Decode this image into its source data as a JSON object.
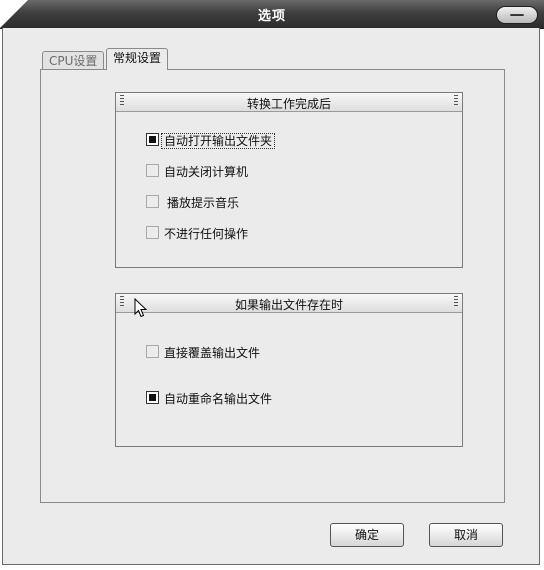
{
  "window": {
    "title": "选项",
    "close_glyph": "—"
  },
  "tabs": [
    {
      "label": "CPU设置",
      "active": false
    },
    {
      "label": "常规设置",
      "active": true
    }
  ],
  "group_after_convert": {
    "title": "转换工作完成后",
    "options": [
      {
        "label": "自动打开输出文件夹",
        "checked": true
      },
      {
        "label": "自动关闭计算机",
        "checked": false
      },
      {
        "label": "播放提示音乐",
        "checked": false
      },
      {
        "label": "不进行任何操作",
        "checked": false
      }
    ]
  },
  "group_file_exists": {
    "title": "如果输出文件存在时",
    "options": [
      {
        "label": "直接覆盖输出文件",
        "checked": false
      },
      {
        "label": "自动重命名输出文件",
        "checked": true
      }
    ]
  },
  "buttons": {
    "ok": "确定",
    "cancel": "取消"
  },
  "icons": {
    "close": "close-icon",
    "grip": "grip-icon",
    "cursor": "mouse-pointer-icon"
  }
}
